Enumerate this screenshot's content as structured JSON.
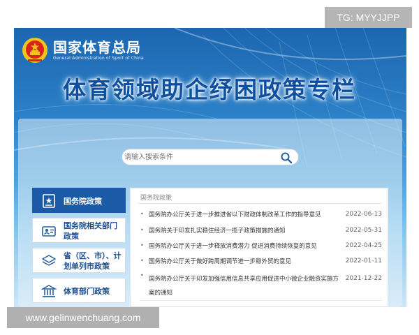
{
  "watermarks": {
    "top_right": "TG: MYYJJPP",
    "bottom_left": "www.gelinwenchuang.com"
  },
  "header": {
    "org_name_cn": "国家体育总局",
    "org_name_en": "General Administration of Sport of China",
    "headline": "体育领域助企纾困政策专栏",
    "logo_icon": "national-emblem-icon"
  },
  "search": {
    "placeholder": "请输入搜索条件",
    "icon": "search-icon"
  },
  "sidebar": {
    "items": [
      {
        "label": "国务院政策",
        "icon": "document-star-icon",
        "active": true
      },
      {
        "label": "国务院相关部门政策",
        "icon": "id-badge-icon",
        "active": false
      },
      {
        "label": "省（区、市）、计划单列市政策",
        "icon": "layers-icon",
        "active": false
      },
      {
        "label": "体育部门政策",
        "icon": "building-icon",
        "active": false
      }
    ]
  },
  "policy_list": {
    "section_title": "国务院政策",
    "items": [
      {
        "title": "国务院办公厅关于进一步推进省以下财政体制改革工作的指导意见",
        "date": "2022-06-13"
      },
      {
        "title": "国务院关于印发扎实稳住经济一揽子政策措施的通知",
        "date": "2022-05-31"
      },
      {
        "title": "国务院办公厅关于进一步释放消费潜力 促进消费持续恢复的意见",
        "date": "2022-04-25"
      },
      {
        "title": "国务院办公厅关于做好跨周期调节进一步稳外贸的意见",
        "date": "2022-01-11"
      },
      {
        "title": "国务院办公厅关于印发加强信用信息共享应用促进中小微企业融资实施方案的通知",
        "date": "2021-12-22"
      }
    ]
  },
  "colors": {
    "primary_blue": "#1b5aa6",
    "headline_blue": "#0f4fa0",
    "banner_top": "#1c66b0",
    "banner_bottom": "#cde6f6",
    "emblem_red": "#d8241c",
    "emblem_gold": "#f2c318"
  }
}
